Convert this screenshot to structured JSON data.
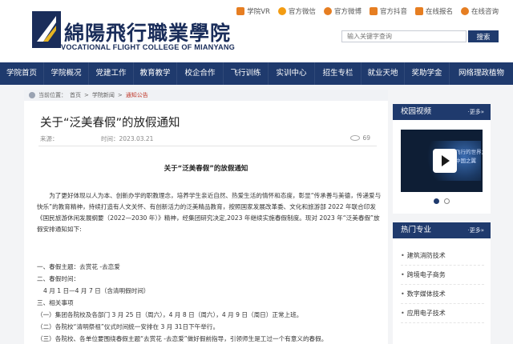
{
  "header": {
    "logo_cn": "綿陽飛行職業學院",
    "logo_en": "VOCATIONAL FLIGHT COLLEGE OF MIANYANG",
    "top_links": [
      {
        "label": "学院VR",
        "icon": "vr-icon",
        "color": "#e67e22"
      },
      {
        "label": "官方微信",
        "icon": "wechat-icon",
        "color": "#f39c12"
      },
      {
        "label": "官方微博",
        "icon": "weibo-icon",
        "color": "#e67e22"
      },
      {
        "label": "官方抖音",
        "icon": "douyin-icon",
        "color": "#e67e22"
      },
      {
        "label": "在线报名",
        "icon": "signup-icon",
        "color": "#e67e22"
      },
      {
        "label": "在线咨询",
        "icon": "consult-icon",
        "color": "#e67e22"
      }
    ],
    "search_placeholder": "输入关键字查询",
    "search_button": "搜索"
  },
  "nav": {
    "items": [
      "学院首页",
      "学院概况",
      "党建工作",
      "教育教学",
      "校企合作",
      "飞行训练",
      "实训中心",
      "招生专栏",
      "就业天地",
      "奖助学金",
      "网络理政植物"
    ]
  },
  "breadcrumb": {
    "prefix": "当前位置：",
    "home": "首页",
    "sep1": ">",
    "section": "学院新闻",
    "sep2": ">",
    "current": "通知公告"
  },
  "article": {
    "title": "关于“泛美春假”的放假通知",
    "source_label": "来源：",
    "time_label": "时间：",
    "time_value": "2023.03.21",
    "views": "69",
    "doc_title": "关于“泛美春假”的放假通知",
    "para1": "为了更好体现以人为本、创新办学的职教理念，培养学生亲近自然、热爱生活的情怀和态度，彰显“传承善与美德，传递爱与快乐”的教育精神，持续打造有人文关怀、有创新活力的泛美精品教育，按照国家发展改革委、文化和旅游部 2022 年联合印发《国民旅游休闲发展纲要（2022—2030 年）》精神，经集团研究决定,2023 年继续实施春假制度。现对 2023 年“泛美春假”放假安排通知如下:",
    "line1": "一、春假主题：去赏花 -去恋爱",
    "line2": "二、春假时间：",
    "line3": "4 月 1 日—4 月 7 日（含清明假时间）",
    "line4": "三、相关事项",
    "line5": "（一）集团各院校及各部门 3 月 25 日（周六），4 月 8 日（周六），4 月 9 日（周日）正常上班。",
    "line6": "（二）各院校“清明祭祖”仪式时间统一安排在 3 月 31日下午举行。",
    "line7": "（三）各院校、各单位要围绕春假主题“去赏花 -去恋爱”做好假前指导，引领师生是工过一个有意义的春假。"
  },
  "sidebar": {
    "video_title": "校园视频",
    "video_more": "·更多»",
    "video_text1": "飞行的世界之",
    "video_text2": "中国之翼",
    "hot_title": "热门专业",
    "hot_more": "·更多»",
    "hot_items": [
      "建筑消防技术",
      "跨境电子商务",
      "数字媒体技术",
      "应用电子技术"
    ]
  }
}
